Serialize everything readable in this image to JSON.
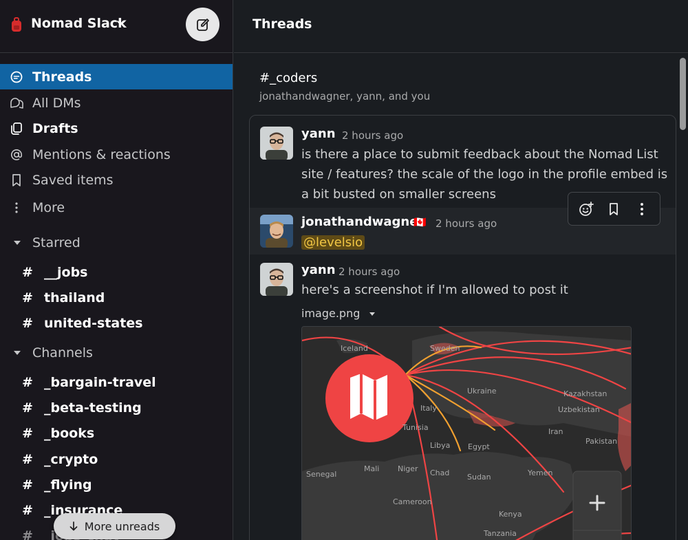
{
  "workspace": {
    "name": "Nomad Slack"
  },
  "sidebar": {
    "nav": [
      {
        "label": "Threads",
        "icon": "threads-icon",
        "active": true
      },
      {
        "label": "All DMs",
        "icon": "dms-icon"
      },
      {
        "label": "Drafts",
        "icon": "drafts-icon",
        "bold": true
      },
      {
        "label": "Mentions & reactions",
        "icon": "at-icon"
      },
      {
        "label": "Saved items",
        "icon": "bookmark-icon"
      },
      {
        "label": "More",
        "icon": "more-vertical-icon"
      }
    ],
    "starred_label": "Starred",
    "starred": [
      "__jobs",
      "thailand",
      "united-states"
    ],
    "channels_label": "Channels",
    "channels": [
      "_bargain-travel",
      "_beta-testing",
      "_books",
      "_crypto",
      "_flying",
      "_insurance",
      "_jobs-chat"
    ],
    "hash": "#",
    "more_unreads": "More unreads"
  },
  "main": {
    "title": "Threads",
    "thread": {
      "channel": "#_coders",
      "participants": "jonathandwagner, yann, and you",
      "messages": [
        {
          "author": "yann",
          "time": "2 hours ago",
          "text": "is there a place to submit feedback about the Nomad List site / features? the scale of the logo in the profile embed is a bit busted on smaller screens"
        },
        {
          "author": "jonathandwagner",
          "flag": "🇨🇦",
          "time": "2 hours ago",
          "mention": "@levelsio"
        },
        {
          "author": "yann",
          "time": "2 hours ago",
          "text": "here's a screenshot if I'm allowed to post it",
          "file": "image.png"
        }
      ]
    },
    "map_labels": [
      "Iceland",
      "Sweden",
      "Ukraine",
      "Kazakhstan",
      "Uzbekistan",
      "Italy",
      "Tunisia",
      "Iran",
      "Pakistan",
      "Libya",
      "Egypt",
      "Senegal",
      "Mali",
      "Niger",
      "Chad",
      "Sudan",
      "Yemen",
      "Cameroon",
      "Kenya",
      "Tanzania"
    ]
  },
  "colors": {
    "active_nav": "#1164a3",
    "sidebar_bg": "#19171d",
    "main_bg": "#1a1d21",
    "mention_bg": "#5e4a16",
    "mention_fg": "#f2c744",
    "brand_red": "#ef4444"
  }
}
